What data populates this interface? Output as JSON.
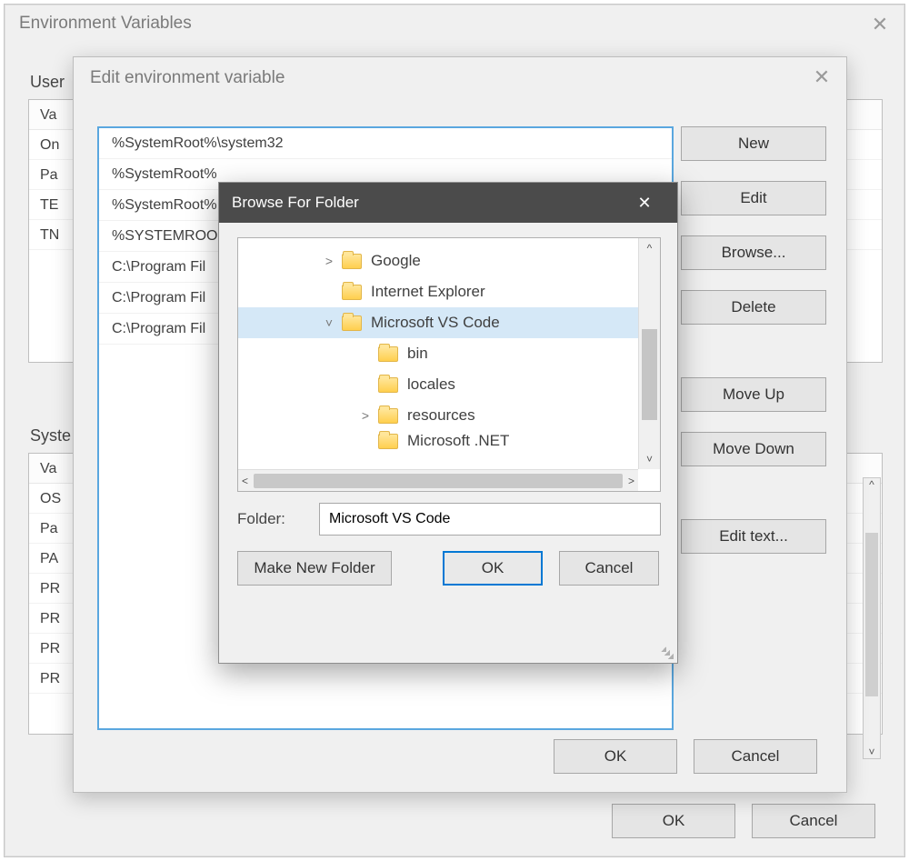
{
  "env": {
    "title": "Environment Variables",
    "user_section": "User",
    "sys_section": "Syste",
    "user_vars_header": "Va",
    "user_vars": [
      "On",
      "Pa",
      "TE",
      "TN"
    ],
    "sys_vars_header": "Va",
    "sys_vars": [
      "OS",
      "Pa",
      "PA",
      "PR",
      "PR",
      "PR",
      "PR"
    ],
    "ok": "OK",
    "cancel": "Cancel"
  },
  "edit": {
    "title": "Edit environment variable",
    "entries": [
      "%SystemRoot%\\system32",
      "%SystemRoot%",
      "%SystemRoot%",
      "%SYSTEMROO",
      "C:\\Program Fil",
      "C:\\Program Fil",
      "C:\\Program Fil"
    ],
    "buttons": {
      "new": "New",
      "edit": "Edit",
      "browse": "Browse...",
      "delete": "Delete",
      "move_up": "Move Up",
      "move_down": "Move Down",
      "edit_text": "Edit text..."
    },
    "ok": "OK",
    "cancel": "Cancel"
  },
  "browse": {
    "title": "Browse For Folder",
    "tree": [
      {
        "depth": 1,
        "expander": ">",
        "label": "Google",
        "selected": false
      },
      {
        "depth": 1,
        "expander": "",
        "label": "Internet Explorer",
        "selected": false
      },
      {
        "depth": 1,
        "expander": "v",
        "label": "Microsoft VS Code",
        "selected": true
      },
      {
        "depth": 2,
        "expander": "",
        "label": "bin",
        "selected": false
      },
      {
        "depth": 2,
        "expander": "",
        "label": "locales",
        "selected": false
      },
      {
        "depth": 2,
        "expander": ">",
        "label": "resources",
        "selected": false
      },
      {
        "depth": 2,
        "expander": "",
        "label": "Microsoft .NET",
        "selected": false,
        "cut": true
      }
    ],
    "folder_label": "Folder:",
    "folder_value": "Microsoft VS Code",
    "make_new": "Make New Folder",
    "ok": "OK",
    "cancel": "Cancel"
  }
}
